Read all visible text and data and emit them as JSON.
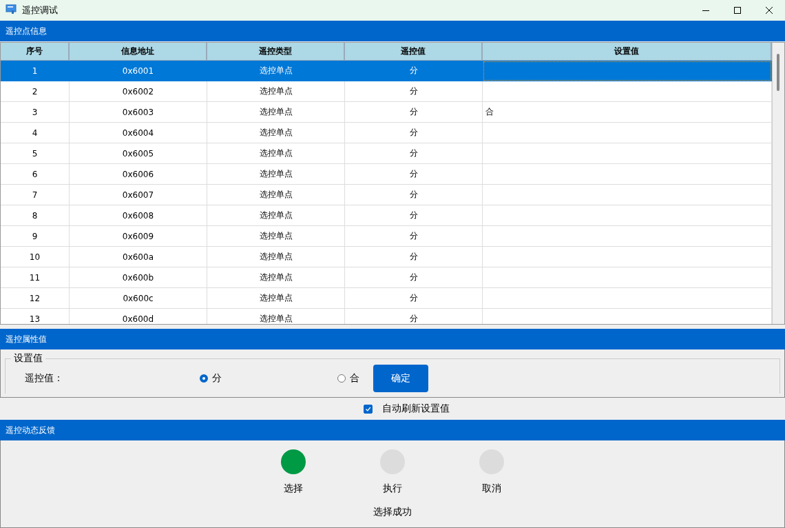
{
  "window": {
    "title": "遥控调试"
  },
  "point_section": {
    "title": "遥控点信息"
  },
  "table": {
    "columns": [
      "序号",
      "信息地址",
      "遥控类型",
      "遥控值",
      "设置值"
    ],
    "rows": [
      {
        "no": "1",
        "address": "0x6001",
        "type": "选控单点",
        "value": "分",
        "setting": "",
        "selected": true
      },
      {
        "no": "2",
        "address": "0x6002",
        "type": "选控单点",
        "value": "分",
        "setting": "",
        "selected": false
      },
      {
        "no": "3",
        "address": "0x6003",
        "type": "选控单点",
        "value": "分",
        "setting": "合",
        "selected": false
      },
      {
        "no": "4",
        "address": "0x6004",
        "type": "选控单点",
        "value": "分",
        "setting": "",
        "selected": false
      },
      {
        "no": "5",
        "address": "0x6005",
        "type": "选控单点",
        "value": "分",
        "setting": "",
        "selected": false
      },
      {
        "no": "6",
        "address": "0x6006",
        "type": "选控单点",
        "value": "分",
        "setting": "",
        "selected": false
      },
      {
        "no": "7",
        "address": "0x6007",
        "type": "选控单点",
        "value": "分",
        "setting": "",
        "selected": false
      },
      {
        "no": "8",
        "address": "0x6008",
        "type": "选控单点",
        "value": "分",
        "setting": "",
        "selected": false
      },
      {
        "no": "9",
        "address": "0x6009",
        "type": "选控单点",
        "value": "分",
        "setting": "",
        "selected": false
      },
      {
        "no": "10",
        "address": "0x600a",
        "type": "选控单点",
        "value": "分",
        "setting": "",
        "selected": false
      },
      {
        "no": "11",
        "address": "0x600b",
        "type": "选控单点",
        "value": "分",
        "setting": "",
        "selected": false
      },
      {
        "no": "12",
        "address": "0x600c",
        "type": "选控单点",
        "value": "分",
        "setting": "",
        "selected": false
      },
      {
        "no": "13",
        "address": "0x600d",
        "type": "选控单点",
        "value": "分",
        "setting": "",
        "selected": false
      }
    ]
  },
  "attr_section": {
    "title": "遥控属性值",
    "group_title": "设置值",
    "label": "遥控值：",
    "options": [
      {
        "label": "分",
        "selected": true
      },
      {
        "label": "合",
        "selected": false
      }
    ],
    "confirm_button": "确定"
  },
  "auto_refresh": {
    "label": "自动刷新设置值",
    "checked": true
  },
  "feedback_section": {
    "title": "遥控动态反馈",
    "steps": [
      {
        "label": "选择",
        "active": true
      },
      {
        "label": "执行",
        "active": false
      },
      {
        "label": "取消",
        "active": false
      }
    ],
    "status": "选择成功"
  }
}
